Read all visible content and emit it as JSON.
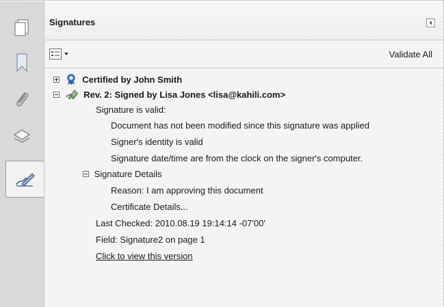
{
  "panel": {
    "title": "Signatures",
    "validate_all_label": "Validate All"
  },
  "rail": {
    "items": [
      {
        "icon": "pages-icon"
      },
      {
        "icon": "bookmark-icon"
      },
      {
        "icon": "attachment-icon"
      },
      {
        "icon": "layers-icon"
      },
      {
        "icon": "signature-pen-icon",
        "active": true
      }
    ]
  },
  "signatures": {
    "certified": {
      "label": "Certified by John Smith",
      "icon": "certified-ribbon-icon"
    },
    "rev2": {
      "label": "Rev. 2: Signed by Lisa Jones <lisa@kahili.com>",
      "icon": "valid-signature-icon",
      "status": "Signature is valid:",
      "status_details": [
        "Document has not been modified since this signature was applied",
        "Signer's identity is valid",
        "Signature date/time are from the clock on the signer's computer."
      ],
      "details_label": "Signature Details",
      "reason": "Reason: I am approving this document",
      "certificate_details": "Certificate Details...",
      "last_checked": "Last Checked: 2010.08.19 19:14:14 -07'00'",
      "field": "Field: Signature2 on page 1",
      "view_version": "Click to view this version"
    }
  },
  "colors": {
    "rail_bg": "#d9d9d9",
    "panel_bg": "#f4f4f4",
    "ribbon_blue": "#2f64b8",
    "check_green": "#3b9a2c"
  }
}
